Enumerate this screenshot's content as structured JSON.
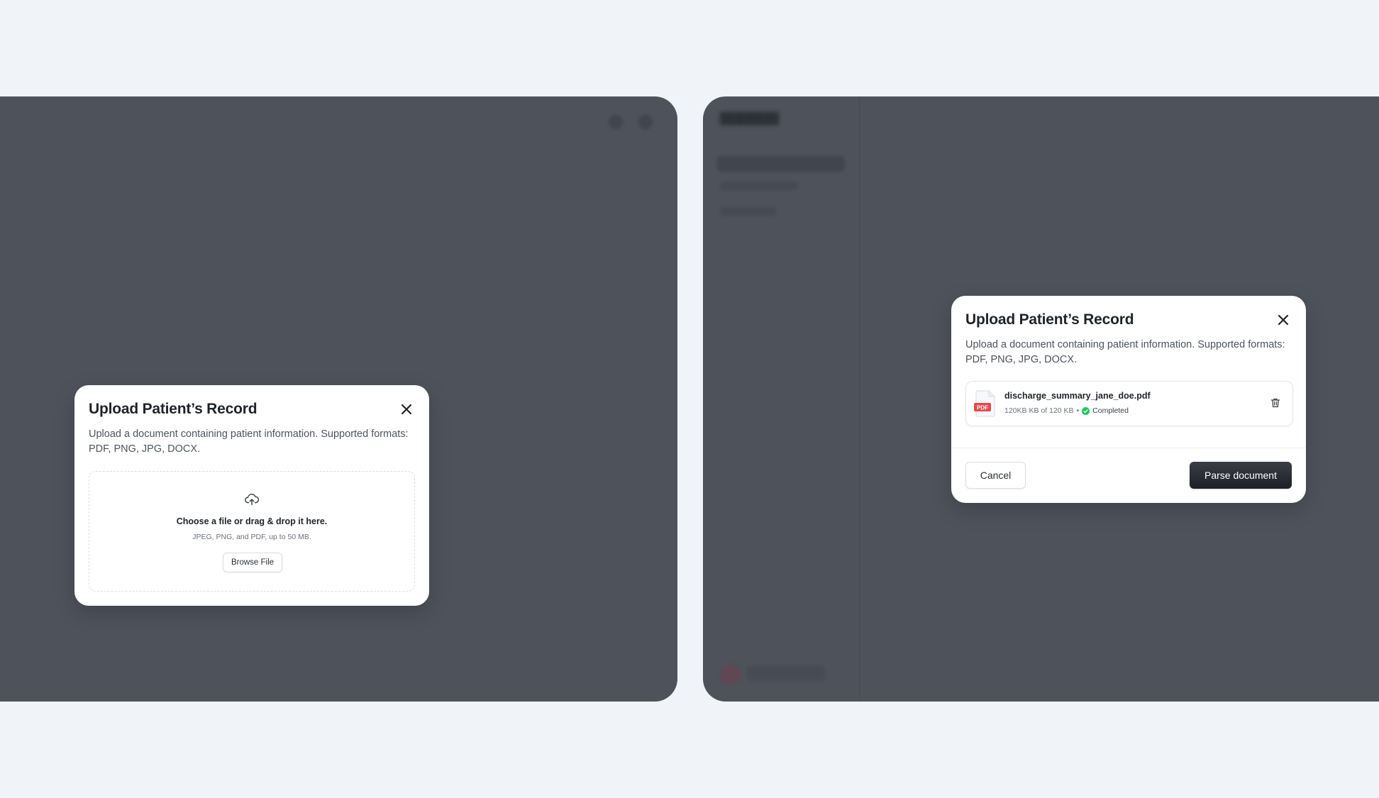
{
  "modal_empty": {
    "title": "Upload Patient’s Record",
    "description": "Upload a document containing patient information. Supported formats: PDF, PNG, JPG, DOCX.",
    "dropzone_title": "Choose a file or drag & drop it here.",
    "dropzone_hint": "JPEG, PNG, and PDF, up to 50 MB.",
    "browse_label": "Browse File"
  },
  "modal_uploaded": {
    "title": "Upload Patient’s Record",
    "description": "Upload a document containing patient information. Supported formats: PDF, PNG, JPG, DOCX.",
    "file": {
      "name": "discharge_summary_jane_doe.pdf",
      "badge": "PDF",
      "size_text": "120KB KB of 120 KB",
      "separator": "•",
      "status": "Completed"
    },
    "cancel_label": "Cancel",
    "parse_label": "Parse document"
  },
  "colors": {
    "overlay": "#4e525b",
    "page_bg": "#f0f3f8",
    "pdf_red": "#e5484d",
    "success_green": "#22c55e",
    "primary_dark": "#1d2026"
  },
  "icons": {
    "close": "close-icon",
    "upload": "cloud-upload-icon",
    "file": "pdf-file-icon",
    "status": "check-circle-icon",
    "delete": "trash-icon"
  }
}
